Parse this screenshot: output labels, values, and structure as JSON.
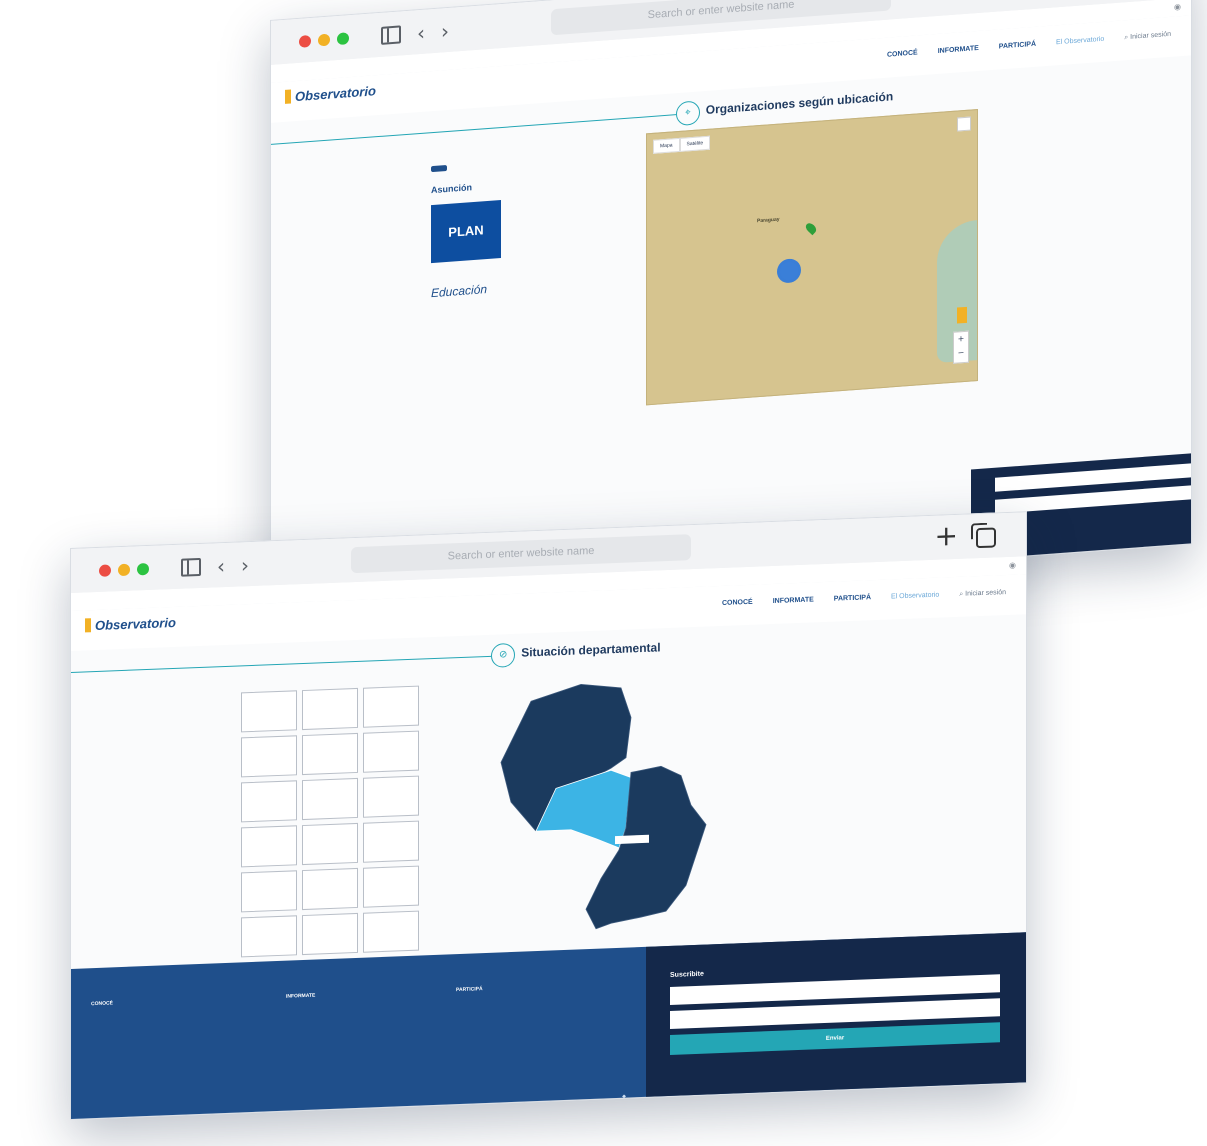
{
  "browser": {
    "address_placeholder": "Search or enter website name",
    "new_tab_symbol": "+",
    "back_symbol": "‹",
    "forward_symbol": "›"
  },
  "site": {
    "logo": "Observatorio",
    "logo_sub": "",
    "nav": [
      "CONOCÉ",
      "INFORMATE",
      "PARTICIPÁ",
      "El Observatorio"
    ],
    "search_label": "Iniciar sesión"
  },
  "back_page": {
    "section_title": "Organizaciones según ubicación",
    "department_badge": "",
    "department": "Asunción",
    "org1_logo": "PLAN",
    "org2_logo": "Educación",
    "org_lines": [
      "",
      "",
      ""
    ],
    "map_tabs": [
      "Mapa",
      "Satélite"
    ],
    "map_labels": [
      "Paraguay"
    ],
    "map_zoom": [
      "+",
      "−"
    ]
  },
  "front_page": {
    "section_title": "Situación departamental",
    "breadcrumb": "",
    "departments": [
      "",
      "",
      "",
      "",
      "",
      "",
      "",
      "",
      "",
      "",
      "",
      "",
      "",
      "",
      "",
      "",
      "",
      ""
    ],
    "map_highlight_label": ""
  },
  "footer": {
    "columns": [
      {
        "head": "CONOCÉ",
        "items": [
          "",
          "",
          "",
          "",
          ""
        ]
      },
      {
        "head": "INFORMATE",
        "items": [
          "",
          "",
          "",
          "",
          ""
        ]
      },
      {
        "head": "PARTICIPÁ",
        "items": [
          "",
          "",
          "",
          ""
        ]
      }
    ],
    "subscribe_head": "Suscribite",
    "name_placeholder": "",
    "email_placeholder": "",
    "submit": "Enviar",
    "contact": [
      "",
      ""
    ]
  },
  "colors": {
    "brand_blue": "#1f4f8b",
    "teal": "#24a6b5",
    "dark_navy": "#14284a",
    "highlight": "#3cb4e5"
  }
}
